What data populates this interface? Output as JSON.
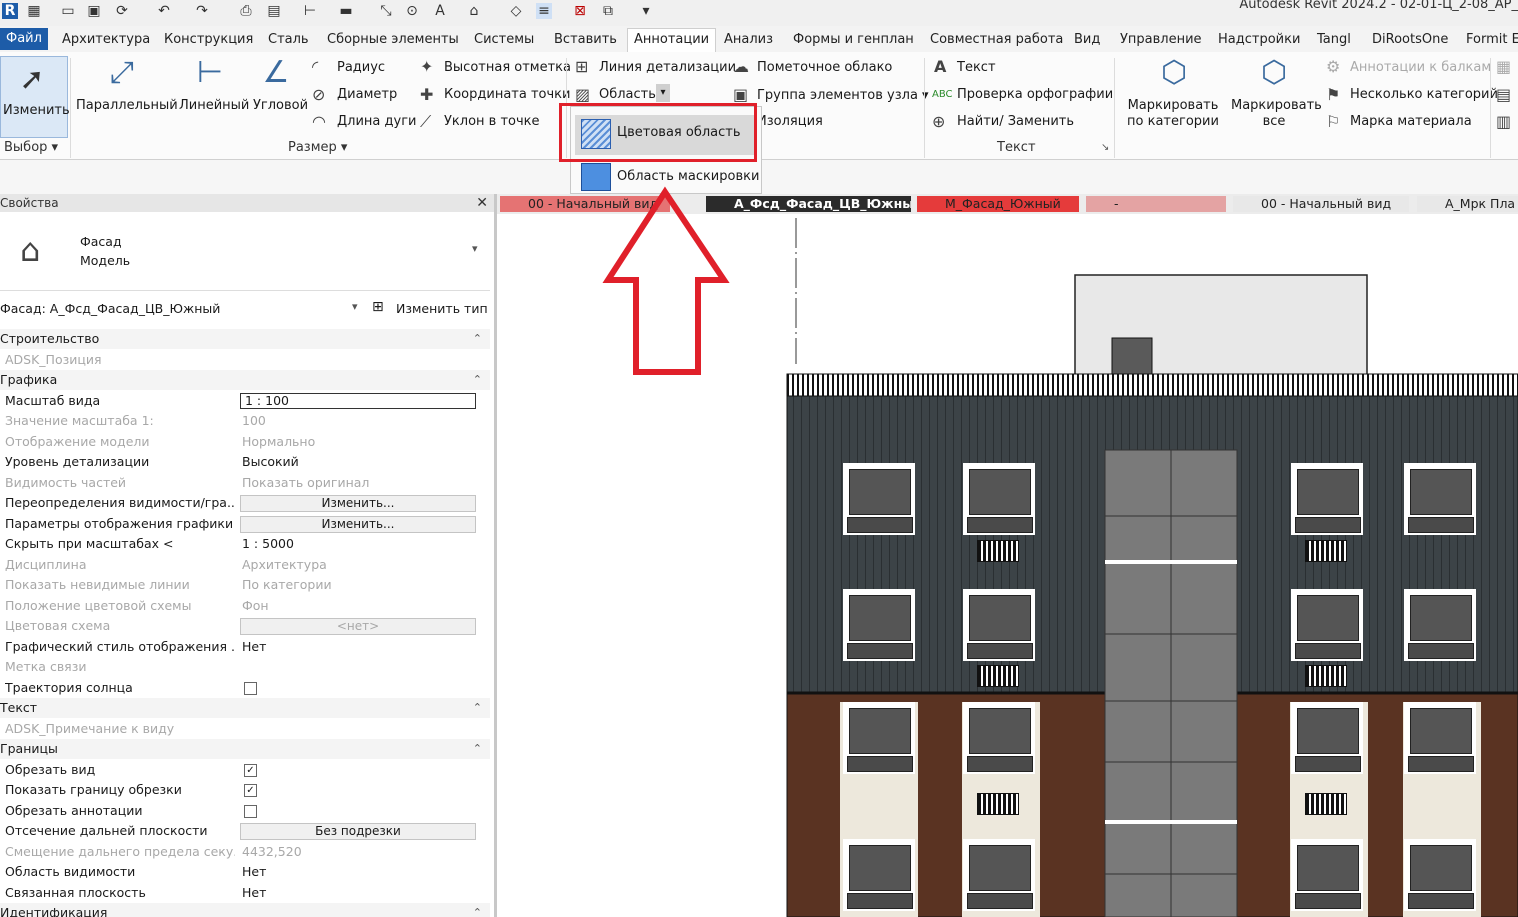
{
  "app_title": "Autodesk Revit 2024.2 - 02-01-Ц_2-08_АР_",
  "menu_tabs": [
    "Файл",
    "Архитектура",
    "Конструкция",
    "Сталь",
    "Сборные элементы",
    "Системы",
    "Вставить",
    "Аннотации",
    "Анализ",
    "Формы и генплан",
    "Совместная работа",
    "Вид",
    "Управление",
    "Надстройки",
    "Tangl",
    "DiRootsOne",
    "Formit E"
  ],
  "active_tab": "Аннотации",
  "ribbon": {
    "modify_label": "Изменить",
    "select_label": "Выбор",
    "dim_buttons": [
      "Параллельный",
      "Линейный",
      "Угловой"
    ],
    "dim_small": [
      "Радиус",
      "Диаметр",
      "Длина дуги"
    ],
    "spot_small": [
      "Высотная отметка",
      "Координата точки",
      "Уклон  в точке"
    ],
    "dim_panel_label": "Размер",
    "detail_small": [
      "Линия детализации",
      "Область"
    ],
    "cloud_small": [
      "Пометочное облако",
      "Группа элементов узла",
      "Изоляция"
    ],
    "text_small": [
      "Текст",
      "Проверка  орфографии",
      "Найти/ Заменить"
    ],
    "text_panel_label": "Текст",
    "tag_by_cat": "Маркировать по категории",
    "tag_all": "Маркировать все",
    "tag_small": [
      "Аннотации к балкам",
      "Несколько категорий",
      "Марка материала"
    ]
  },
  "dropdown": {
    "items": [
      "Цветовая область",
      "Область маскировки"
    ],
    "highlight_color": "#e0202a"
  },
  "properties": {
    "title": "Свойства",
    "type_line1": "Фасад",
    "type_line2": "Модель",
    "selector": "Фасад: А_Фсд_Фасад_ЦВ_Южный",
    "edit_type": "Изменить тип",
    "rows": [
      {
        "kind": "sec",
        "k": "Строительство"
      },
      {
        "kind": "grey",
        "k": "ADSK_Позиция",
        "v": ""
      },
      {
        "kind": "sec",
        "k": "Графика"
      },
      {
        "kind": "input",
        "k": "Масштаб вида",
        "v": "1 : 100"
      },
      {
        "kind": "grey",
        "k": "Значение масштаба    1:",
        "v": "100"
      },
      {
        "kind": "grey",
        "k": "Отображение модели",
        "v": "Нормально"
      },
      {
        "kind": "row",
        "k": "Уровень детализации",
        "v": "Высокий"
      },
      {
        "kind": "grey",
        "k": "Видимость частей",
        "v": "Показать оригинал"
      },
      {
        "kind": "btn",
        "k": "Переопределения видимости/гра...",
        "v": "Изменить..."
      },
      {
        "kind": "btn",
        "k": "Параметры отображения графики",
        "v": "Изменить..."
      },
      {
        "kind": "row",
        "k": "Скрыть при масштабах <",
        "v": "1 : 5000"
      },
      {
        "kind": "grey",
        "k": "Дисциплина",
        "v": "Архитектура"
      },
      {
        "kind": "grey",
        "k": "Показать невидимые линии",
        "v": "По категории"
      },
      {
        "kind": "grey",
        "k": "Положение цветовой схемы",
        "v": "Фон"
      },
      {
        "kind": "greybtn",
        "k": "Цветовая схема",
        "v": "<нет>"
      },
      {
        "kind": "row",
        "k": "Графический стиль отображения ...",
        "v": "Нет"
      },
      {
        "kind": "grey",
        "k": "Метка связи",
        "v": ""
      },
      {
        "kind": "chk",
        "k": "Траектория солнца",
        "v": ""
      },
      {
        "kind": "sec",
        "k": "Текст"
      },
      {
        "kind": "grey",
        "k": "ADSK_Примечание к виду",
        "v": ""
      },
      {
        "kind": "sec",
        "k": "Границы"
      },
      {
        "kind": "chk",
        "k": "Обрезать вид",
        "v": "✓"
      },
      {
        "kind": "chk",
        "k": "Показать границу обрезки",
        "v": "✓"
      },
      {
        "kind": "chk",
        "k": "Обрезать аннотации",
        "v": ""
      },
      {
        "kind": "btn",
        "k": "Отсечение дальней плоскости",
        "v": "Без подрезки"
      },
      {
        "kind": "grey",
        "k": "Смещение дальнего предела секу...",
        "v": "4432,520"
      },
      {
        "kind": "row",
        "k": "Область видимости",
        "v": "Нет"
      },
      {
        "kind": "row",
        "k": "Связанная плоскость",
        "v": "Нет"
      },
      {
        "kind": "sec",
        "k": "Идентификация"
      }
    ]
  },
  "view_tabs": [
    "00 - Начальный вид",
    "А_Фсд_Фасад_ЦВ_Южный",
    "М_Фасад_Южный",
    "-",
    "00 - Начальный вид",
    "А_Мрк Пла"
  ]
}
